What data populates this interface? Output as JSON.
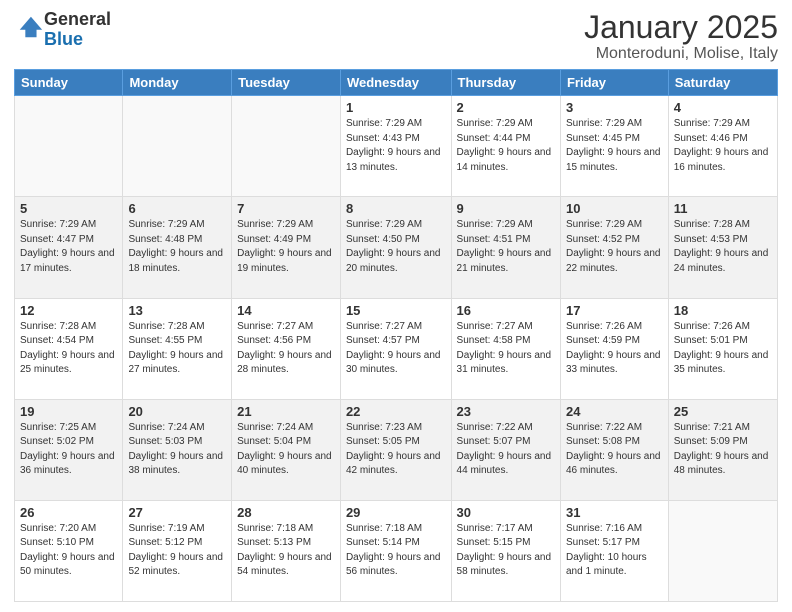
{
  "logo": {
    "general": "General",
    "blue": "Blue"
  },
  "header": {
    "month": "January 2025",
    "location": "Monteroduni, Molise, Italy"
  },
  "weekdays": [
    "Sunday",
    "Monday",
    "Tuesday",
    "Wednesday",
    "Thursday",
    "Friday",
    "Saturday"
  ],
  "weeks": [
    [
      {
        "day": "",
        "info": ""
      },
      {
        "day": "",
        "info": ""
      },
      {
        "day": "",
        "info": ""
      },
      {
        "day": "1",
        "info": "Sunrise: 7:29 AM\nSunset: 4:43 PM\nDaylight: 9 hours\nand 13 minutes."
      },
      {
        "day": "2",
        "info": "Sunrise: 7:29 AM\nSunset: 4:44 PM\nDaylight: 9 hours\nand 14 minutes."
      },
      {
        "day": "3",
        "info": "Sunrise: 7:29 AM\nSunset: 4:45 PM\nDaylight: 9 hours\nand 15 minutes."
      },
      {
        "day": "4",
        "info": "Sunrise: 7:29 AM\nSunset: 4:46 PM\nDaylight: 9 hours\nand 16 minutes."
      }
    ],
    [
      {
        "day": "5",
        "info": "Sunrise: 7:29 AM\nSunset: 4:47 PM\nDaylight: 9 hours\nand 17 minutes."
      },
      {
        "day": "6",
        "info": "Sunrise: 7:29 AM\nSunset: 4:48 PM\nDaylight: 9 hours\nand 18 minutes."
      },
      {
        "day": "7",
        "info": "Sunrise: 7:29 AM\nSunset: 4:49 PM\nDaylight: 9 hours\nand 19 minutes."
      },
      {
        "day": "8",
        "info": "Sunrise: 7:29 AM\nSunset: 4:50 PM\nDaylight: 9 hours\nand 20 minutes."
      },
      {
        "day": "9",
        "info": "Sunrise: 7:29 AM\nSunset: 4:51 PM\nDaylight: 9 hours\nand 21 minutes."
      },
      {
        "day": "10",
        "info": "Sunrise: 7:29 AM\nSunset: 4:52 PM\nDaylight: 9 hours\nand 22 minutes."
      },
      {
        "day": "11",
        "info": "Sunrise: 7:28 AM\nSunset: 4:53 PM\nDaylight: 9 hours\nand 24 minutes."
      }
    ],
    [
      {
        "day": "12",
        "info": "Sunrise: 7:28 AM\nSunset: 4:54 PM\nDaylight: 9 hours\nand 25 minutes."
      },
      {
        "day": "13",
        "info": "Sunrise: 7:28 AM\nSunset: 4:55 PM\nDaylight: 9 hours\nand 27 minutes."
      },
      {
        "day": "14",
        "info": "Sunrise: 7:27 AM\nSunset: 4:56 PM\nDaylight: 9 hours\nand 28 minutes."
      },
      {
        "day": "15",
        "info": "Sunrise: 7:27 AM\nSunset: 4:57 PM\nDaylight: 9 hours\nand 30 minutes."
      },
      {
        "day": "16",
        "info": "Sunrise: 7:27 AM\nSunset: 4:58 PM\nDaylight: 9 hours\nand 31 minutes."
      },
      {
        "day": "17",
        "info": "Sunrise: 7:26 AM\nSunset: 4:59 PM\nDaylight: 9 hours\nand 33 minutes."
      },
      {
        "day": "18",
        "info": "Sunrise: 7:26 AM\nSunset: 5:01 PM\nDaylight: 9 hours\nand 35 minutes."
      }
    ],
    [
      {
        "day": "19",
        "info": "Sunrise: 7:25 AM\nSunset: 5:02 PM\nDaylight: 9 hours\nand 36 minutes."
      },
      {
        "day": "20",
        "info": "Sunrise: 7:24 AM\nSunset: 5:03 PM\nDaylight: 9 hours\nand 38 minutes."
      },
      {
        "day": "21",
        "info": "Sunrise: 7:24 AM\nSunset: 5:04 PM\nDaylight: 9 hours\nand 40 minutes."
      },
      {
        "day": "22",
        "info": "Sunrise: 7:23 AM\nSunset: 5:05 PM\nDaylight: 9 hours\nand 42 minutes."
      },
      {
        "day": "23",
        "info": "Sunrise: 7:22 AM\nSunset: 5:07 PM\nDaylight: 9 hours\nand 44 minutes."
      },
      {
        "day": "24",
        "info": "Sunrise: 7:22 AM\nSunset: 5:08 PM\nDaylight: 9 hours\nand 46 minutes."
      },
      {
        "day": "25",
        "info": "Sunrise: 7:21 AM\nSunset: 5:09 PM\nDaylight: 9 hours\nand 48 minutes."
      }
    ],
    [
      {
        "day": "26",
        "info": "Sunrise: 7:20 AM\nSunset: 5:10 PM\nDaylight: 9 hours\nand 50 minutes."
      },
      {
        "day": "27",
        "info": "Sunrise: 7:19 AM\nSunset: 5:12 PM\nDaylight: 9 hours\nand 52 minutes."
      },
      {
        "day": "28",
        "info": "Sunrise: 7:18 AM\nSunset: 5:13 PM\nDaylight: 9 hours\nand 54 minutes."
      },
      {
        "day": "29",
        "info": "Sunrise: 7:18 AM\nSunset: 5:14 PM\nDaylight: 9 hours\nand 56 minutes."
      },
      {
        "day": "30",
        "info": "Sunrise: 7:17 AM\nSunset: 5:15 PM\nDaylight: 9 hours\nand 58 minutes."
      },
      {
        "day": "31",
        "info": "Sunrise: 7:16 AM\nSunset: 5:17 PM\nDaylight: 10 hours\nand 1 minute."
      },
      {
        "day": "",
        "info": ""
      }
    ]
  ]
}
